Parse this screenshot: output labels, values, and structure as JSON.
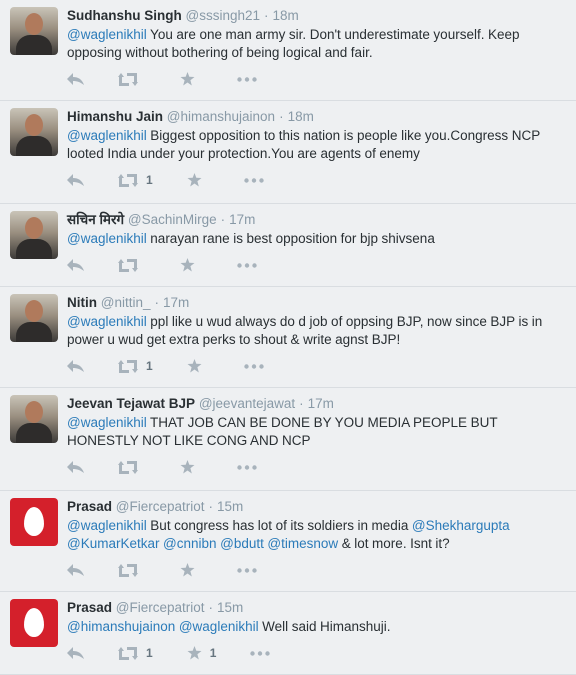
{
  "tweets": [
    {
      "name": "Sudhanshu Singh",
      "handle": "@sssingh21",
      "time": "18m",
      "avatar": "photo",
      "parts": [
        {
          "t": "@waglenikhil",
          "m": true
        },
        {
          "t": " You are one man army sir. Don't underestimate yourself. Keep opposing without bothering of being logical and fair.",
          "m": false
        }
      ],
      "retweets": "",
      "favorites": ""
    },
    {
      "name": "Himanshu Jain",
      "handle": "@himanshujainon",
      "time": "18m",
      "avatar": "photo",
      "parts": [
        {
          "t": "@waglenikhil",
          "m": true
        },
        {
          "t": " Biggest opposition to this nation is people like you.Congress NCP looted India under your protection.You are agents of enemy",
          "m": false
        }
      ],
      "retweets": "1",
      "favorites": ""
    },
    {
      "name": "सचिन मिरगे",
      "handle": "@SachinMirge",
      "time": "17m",
      "avatar": "photo",
      "parts": [
        {
          "t": "@waglenikhil",
          "m": true
        },
        {
          "t": "  narayan rane is best opposition for bjp shivsena",
          "m": false
        }
      ],
      "retweets": "",
      "favorites": ""
    },
    {
      "name": "Nitin",
      "handle": "@nittin_",
      "time": "17m",
      "avatar": "photo",
      "parts": [
        {
          "t": "@waglenikhil",
          "m": true
        },
        {
          "t": " ppl like u wud always do d job of oppsing BJP, now since BJP is in power u wud get extra perks to shout & write agnst BJP!",
          "m": false
        }
      ],
      "retweets": "1",
      "favorites": ""
    },
    {
      "name": "Jeevan Tejawat BJP",
      "handle": "@jeevantejawat",
      "time": "17m",
      "avatar": "photo",
      "parts": [
        {
          "t": "@waglenikhil",
          "m": true
        },
        {
          "t": " THAT JOB CAN BE DONE BY YOU MEDIA PEOPLE BUT HONESTLY NOT LIKE CONG AND NCP",
          "m": false
        }
      ],
      "retweets": "",
      "favorites": ""
    },
    {
      "name": "Prasad",
      "handle": "@Fiercepatriot",
      "time": "15m",
      "avatar": "egg",
      "parts": [
        {
          "t": "@waglenikhil",
          "m": true
        },
        {
          "t": " But congress has lot of its soldiers in media ",
          "m": false
        },
        {
          "t": "@Shekhargupta",
          "m": true
        },
        {
          "t": " ",
          "m": false
        },
        {
          "t": "@KumarKetkar",
          "m": true
        },
        {
          "t": " ",
          "m": false
        },
        {
          "t": "@cnnibn",
          "m": true
        },
        {
          "t": " ",
          "m": false
        },
        {
          "t": "@bdutt",
          "m": true
        },
        {
          "t": " ",
          "m": false
        },
        {
          "t": "@timesnow",
          "m": true
        },
        {
          "t": " & lot more. Isnt it?",
          "m": false
        }
      ],
      "retweets": "",
      "favorites": ""
    },
    {
      "name": "Prasad",
      "handle": "@Fiercepatriot",
      "time": "15m",
      "avatar": "egg",
      "parts": [
        {
          "t": "@himanshujainon",
          "m": true
        },
        {
          "t": " ",
          "m": false
        },
        {
          "t": "@waglenikhil",
          "m": true
        },
        {
          "t": " Well said Himanshuji.",
          "m": false
        }
      ],
      "retweets": "1",
      "favorites": "1"
    }
  ],
  "separator": "·",
  "icons": {
    "reply": "reply-icon",
    "retweet": "retweet-icon",
    "favorite": "star-icon",
    "more": "more-icon"
  },
  "colors": {
    "background": "#eef0f2",
    "link": "#2b7bb9",
    "muted": "#8899a6",
    "action": "#a8b3bc",
    "egg": "#d4202b"
  }
}
